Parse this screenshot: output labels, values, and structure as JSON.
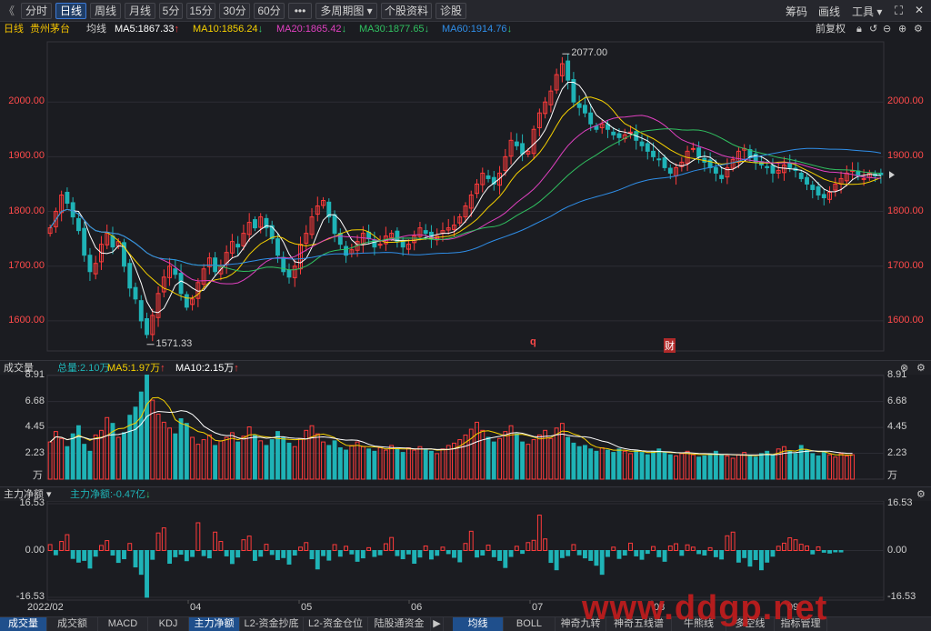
{
  "toolbar": {
    "collapse_icon": "double-chevron-left-icon",
    "tabs": [
      "分时",
      "日线",
      "周线",
      "月线",
      "5分",
      "15分",
      "30分",
      "60分",
      "•••",
      "多周期图 ▾",
      "个股资料",
      "诊股"
    ],
    "active_tab": "日线",
    "right_items": [
      "筹码",
      "画线",
      "工具 ▾"
    ]
  },
  "info": {
    "period": "日线",
    "stock_name": "贵州茅台",
    "ma_label": "均线",
    "ma5": "MA5:1867.33",
    "ma10": "MA10:1856.24",
    "ma20": "MA20:1865.42",
    "ma30": "MA30:1877.65",
    "ma60": "MA60:1914.76",
    "adjust": "前复权"
  },
  "volume_bar": {
    "title": "成交量",
    "total": "总量:2.10万",
    "ma5": "MA5:1.97万",
    "ma10": "MA10:2.15万"
  },
  "flow_bar": {
    "title": "主力净额 ▾",
    "value": "主力净额:-0.47亿"
  },
  "bottom_tabs": [
    "成交量",
    "成交额",
    "MACD",
    "KDJ",
    "主力净额",
    "L2-资金抄底",
    "L2-资金仓位",
    "陆股通资金",
    "▶",
    "均线",
    "BOLL",
    "神奇九转",
    "神奇五线谱",
    "牛熊线",
    "多空线",
    "指标管理"
  ],
  "bottom_active": [
    "成交量",
    "主力净额",
    "均线"
  ],
  "watermark": "www.ddgp.net",
  "colors": {
    "up": "#ff3b3b",
    "down": "#1fb3b6",
    "ma5": "#ffffff",
    "ma10": "#f5d000",
    "ma20": "#e040c0",
    "ma30": "#30c060",
    "ma60": "#2f8ee8"
  },
  "chart_data": [
    {
      "type": "candlestick",
      "title": "贵州茅台 日线",
      "x_ticks": [
        "2022/02",
        "04",
        "05",
        "06",
        "07",
        "08",
        "09"
      ],
      "y_ticks": [
        1600.0,
        1700.0,
        1800.0,
        1900.0,
        2000.0
      ],
      "ylim": [
        1545,
        2110
      ],
      "high_annotation": "2077.00",
      "low_annotation": "1571.33",
      "markers": [
        "q",
        "财"
      ],
      "ma_values_latest": {
        "MA5": 1867.33,
        "MA10": 1856.24,
        "MA20": 1865.42,
        "MA30": 1877.65,
        "MA60": 1914.76
      },
      "closes": [
        1770,
        1800,
        1830,
        1815,
        1790,
        1765,
        1720,
        1690,
        1705,
        1740,
        1760,
        1735,
        1745,
        1700,
        1660,
        1640,
        1600,
        1575,
        1610,
        1650,
        1680,
        1700,
        1685,
        1650,
        1625,
        1640,
        1670,
        1695,
        1715,
        1690,
        1700,
        1725,
        1745,
        1735,
        1760,
        1780,
        1770,
        1790,
        1770,
        1750,
        1720,
        1690,
        1680,
        1700,
        1740,
        1760,
        1790,
        1810,
        1820,
        1790,
        1760,
        1740,
        1720,
        1730,
        1745,
        1760,
        1750,
        1735,
        1740,
        1755,
        1760,
        1745,
        1735,
        1740,
        1755,
        1770,
        1760,
        1750,
        1755,
        1765,
        1770,
        1775,
        1790,
        1810,
        1830,
        1850,
        1870,
        1860,
        1850,
        1870,
        1900,
        1930,
        1920,
        1905,
        1910,
        1950,
        1980,
        2000,
        2020,
        2050,
        2070,
        2040,
        2000,
        1990,
        1980,
        1960,
        1950,
        1960,
        1950,
        1940,
        1935,
        1940,
        1945,
        1930,
        1920,
        1910,
        1900,
        1895,
        1880,
        1870,
        1880,
        1890,
        1910,
        1915,
        1900,
        1890,
        1880,
        1870,
        1860,
        1880,
        1895,
        1910,
        1915,
        1900,
        1890,
        1885,
        1880,
        1870,
        1875,
        1885,
        1880,
        1875,
        1860,
        1850,
        1840,
        1830,
        1825,
        1835,
        1850,
        1860,
        1870,
        1875,
        1865,
        1860,
        1870,
        1865,
        1867
      ]
    },
    {
      "type": "bar",
      "title": "成交量",
      "unit": "万",
      "y_ticks": [
        2.23,
        4.45,
        6.68,
        8.91
      ],
      "ylim": [
        0,
        9.0
      ],
      "values": [
        3.2,
        4.1,
        3.5,
        2.8,
        3.9,
        4.6,
        3.0,
        2.4,
        3.8,
        4.2,
        5.3,
        4.8,
        3.6,
        4.0,
        5.5,
        6.2,
        7.5,
        9.0,
        6.8,
        5.6,
        4.9,
        4.4,
        3.9,
        5.2,
        4.8,
        3.6,
        3.0,
        3.4,
        3.8,
        2.9,
        3.3,
        3.6,
        4.0,
        3.2,
        3.7,
        4.5,
        3.8,
        3.3,
        2.9,
        3.4,
        4.1,
        3.6,
        3.1,
        2.8,
        3.5,
        4.2,
        4.6,
        3.9,
        3.2,
        2.9,
        3.3,
        2.7,
        2.5,
        2.9,
        3.2,
        2.8,
        2.6,
        2.4,
        2.7,
        2.5,
        2.9,
        2.6,
        2.3,
        2.7,
        2.5,
        2.8,
        2.6,
        2.4,
        2.2,
        2.6,
        2.9,
        3.1,
        3.4,
        3.8,
        4.3,
        4.9,
        4.2,
        3.6,
        3.2,
        3.5,
        4.1,
        4.6,
        3.9,
        3.2,
        3.0,
        3.4,
        3.8,
        4.2,
        3.5,
        4.4,
        4.8,
        3.6,
        3.1,
        2.8,
        2.9,
        2.6,
        2.4,
        2.7,
        2.5,
        2.3,
        2.6,
        2.4,
        2.2,
        2.5,
        2.3,
        2.1,
        2.4,
        2.6,
        2.3,
        2.1,
        2.0,
        2.2,
        2.4,
        2.1,
        1.9,
        2.0,
        2.2,
        2.4,
        2.1,
        2.0,
        1.8,
        2.1,
        2.3,
        2.0,
        1.9,
        2.2,
        2.4,
        2.1,
        2.6,
        2.8,
        2.4,
        2.2,
        2.9,
        2.5,
        2.2,
        2.0,
        2.3,
        2.1,
        1.9,
        2.2,
        2.0,
        2.1
      ]
    },
    {
      "type": "bar",
      "title": "主力净额",
      "unit": "亿",
      "y_ticks": [
        -16.53,
        0.0,
        16.53
      ],
      "ylim": [
        -17.5,
        17.5
      ],
      "values": [
        2.1,
        -1.5,
        3.2,
        5.6,
        -2.8,
        -4.1,
        -3.5,
        -6.2,
        -2.0,
        1.8,
        3.5,
        -1.6,
        -4.2,
        -2.9,
        2.5,
        -5.8,
        -8.4,
        -16.5,
        -3.1,
        6.2,
        8.0,
        -4.5,
        -2.2,
        -1.3,
        -3.6,
        -2.1,
        9.8,
        -1.8,
        -2.6,
        6.5,
        3.2,
        -1.9,
        -4.6,
        -2.3,
        3.8,
        5.1,
        -3.5,
        -2.0,
        2.2,
        -1.4,
        -3.2,
        -2.5,
        -4.8,
        -1.6,
        1.2,
        2.8,
        -2.9,
        -6.5,
        -1.8,
        -3.4,
        2.1,
        -2.0,
        1.5,
        -1.2,
        -3.8,
        -2.6,
        1.0,
        -2.1,
        -1.5,
        2.4,
        4.6,
        -1.8,
        -2.9,
        -1.2,
        -4.5,
        -2.3,
        1.6,
        -3.0,
        -1.7,
        1.2,
        -1.1,
        -2.4,
        -4.0,
        2.5,
        6.8,
        -2.3,
        -1.6,
        1.9,
        -2.2,
        -3.5,
        -6.0,
        -2.1,
        1.5,
        -1.0,
        2.8,
        3.6,
        12.5,
        4.1,
        -4.2,
        -6.8,
        -2.5,
        -1.8,
        2.1,
        -1.5,
        -2.6,
        -3.5,
        -5.2,
        -8.4,
        -2.1,
        1.2,
        -2.8,
        -1.6,
        2.6,
        -1.9,
        -3.1,
        -1.0,
        1.4,
        -2.2,
        -3.8,
        1.6,
        2.4,
        -1.7,
        2.0,
        1.2,
        -1.1,
        -1.6,
        1.0,
        -2.2,
        -3.0,
        5.2,
        6.5,
        -4.1,
        -2.5,
        -5.5,
        -3.2,
        -6.8,
        -4.1,
        -2.0,
        1.5,
        2.6,
        4.5,
        3.8,
        2.2,
        1.6,
        -1.2,
        1.3,
        -0.6,
        -0.9,
        -0.47,
        -0.5
      ]
    }
  ]
}
